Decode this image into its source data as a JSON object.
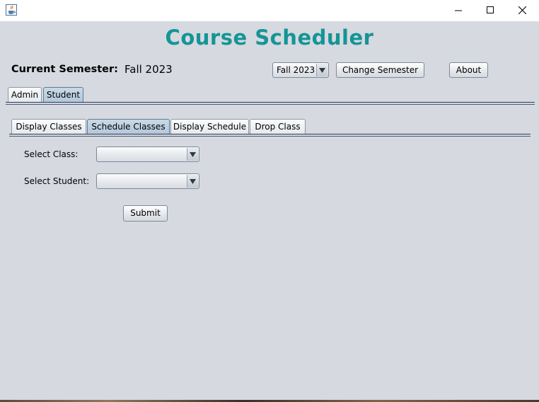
{
  "window": {
    "icon": "java-cup-icon",
    "controls": [
      "minimize-icon",
      "maximize-icon",
      "close-icon"
    ]
  },
  "app": {
    "title": "Course Scheduler",
    "title_color": "#149596"
  },
  "semester": {
    "label": "Current Semester:",
    "value": "Fall 2023",
    "selector_value": "Fall 2023",
    "change_button": "Change Semester",
    "about_button": "About"
  },
  "main_tabs": {
    "admin": "Admin",
    "student": "Student",
    "selected": "Student"
  },
  "student_tabs": {
    "display_classes": "Display Classes",
    "schedule_classes": "Schedule Classes",
    "display_schedule": "Display Schedule",
    "drop_class": "Drop Class",
    "selected": "Schedule Classes"
  },
  "form": {
    "class_label": "Select Class:",
    "class_value": "",
    "student_label": "Select Student:",
    "student_value": "",
    "submit": "Submit"
  },
  "colors": {
    "background": "#d6d9df",
    "selected_tab": "#b8cadb"
  }
}
